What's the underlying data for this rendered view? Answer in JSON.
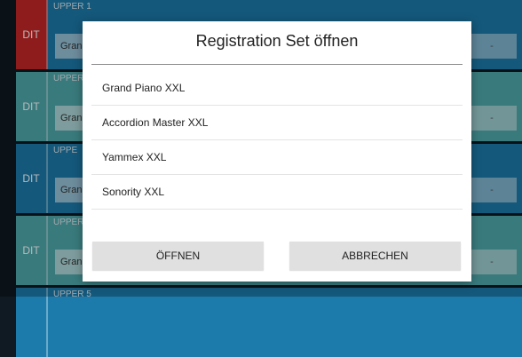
{
  "background": {
    "rows": [
      {
        "edit": "DIT",
        "upper": "UPPER 1",
        "field": "Grand",
        "dash": "-"
      },
      {
        "edit": "DIT",
        "upper": "UPPER",
        "field": "Gran",
        "dash": "-"
      },
      {
        "edit": "DIT",
        "upper": "UPPE",
        "field": "Gran",
        "dash": "-"
      },
      {
        "edit": "DIT",
        "upper": "UPPER",
        "field": "Gran",
        "dash": "-"
      },
      {
        "edit": "",
        "upper": "UPPER 5",
        "field": "",
        "dash": ""
      }
    ]
  },
  "dialog": {
    "title": "Registration Set öffnen",
    "items": [
      {
        "label": "Grand Piano XXL"
      },
      {
        "label": "Accordion Master XXL"
      },
      {
        "label": "Yammex XXL"
      },
      {
        "label": "Sonority XXL"
      }
    ],
    "open_label": "ÖFFNEN",
    "cancel_label": "ABBRECHEN"
  },
  "colors": {
    "row_blue": "#1c7bab",
    "row_teal": "#4fa9ad",
    "edit_red": "#c62828"
  }
}
